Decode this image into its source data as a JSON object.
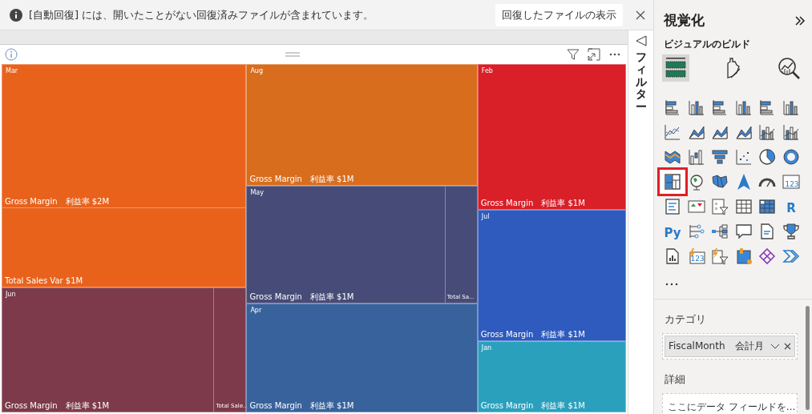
{
  "notification": {
    "message": "[自動回復] には、開いたことがない回復済みファイルが含まれています。",
    "action": "回復したファイルの表示"
  },
  "treemap": {
    "columns": [
      {
        "tiles": [
          {
            "label": "Mar",
            "color": "#e8621c",
            "kind": "rows",
            "segments": [
              {
                "label": "Gross Margin　利益率 $2M"
              },
              {
                "label": "Total Sales Var $1M"
              }
            ]
          },
          {
            "label": "Jun",
            "color": "#7c3a4a",
            "kind": "columns",
            "segments": [
              {
                "label": "Gross Margin　利益率 $1M"
              },
              {
                "label": "Total Sale..."
              }
            ]
          }
        ]
      },
      {
        "tiles": [
          {
            "label": "Aug",
            "color": "#d86d1e",
            "kind": "rows",
            "segments": [
              {
                "label": "Gross Margin　利益率 $1M"
              }
            ]
          },
          {
            "label": "May",
            "color": "#474b77",
            "kind": "columns",
            "segments": [
              {
                "label": "Gross Margin　利益率 $1M"
              },
              {
                "label": "Total Sa..."
              }
            ]
          },
          {
            "label": "Apr",
            "color": "#38629b",
            "kind": "rows",
            "segments": [
              {
                "label": "Gross Margin　利益率 $1M"
              }
            ]
          }
        ]
      },
      {
        "tiles": [
          {
            "label": "Feb",
            "color": "#d91f28",
            "kind": "rows",
            "segments": [
              {
                "label": "Gross Margin　利益率 $1M"
              }
            ]
          },
          {
            "label": "Jul",
            "color": "#2e5bbd",
            "kind": "rows",
            "segments": [
              {
                "label": "Gross Margin　利益率 $1M"
              }
            ]
          },
          {
            "label": "Jan",
            "color": "#2ba0bd",
            "kind": "rows",
            "segments": [
              {
                "label": "Gross Margin　利益率 $1M"
              }
            ]
          }
        ]
      }
    ]
  },
  "filter_pane": {
    "title": "フィルター"
  },
  "visualizations": {
    "title": "視覚化",
    "subtitle": "ビジュアルのビルド",
    "build_tabs": [
      {
        "selected": true
      },
      {
        "selected": false
      },
      {
        "selected": false
      }
    ],
    "visual_types": [
      {
        "kind": "hbar",
        "selected": false
      },
      {
        "kind": "column",
        "selected": false
      },
      {
        "kind": "hbar",
        "selected": false
      },
      {
        "kind": "column",
        "selected": false
      },
      {
        "kind": "hbar",
        "selected": false
      },
      {
        "kind": "column",
        "selected": false
      },
      {
        "kind": "line",
        "selected": false
      },
      {
        "kind": "area",
        "selected": false
      },
      {
        "kind": "area",
        "selected": false
      },
      {
        "kind": "area",
        "selected": false
      },
      {
        "kind": "combo",
        "selected": false
      },
      {
        "kind": "combo",
        "selected": false
      },
      {
        "kind": "ribbon",
        "selected": false
      },
      {
        "kind": "waterfall",
        "selected": false
      },
      {
        "kind": "funnel",
        "selected": false
      },
      {
        "kind": "scatter",
        "selected": false
      },
      {
        "kind": "pie",
        "selected": false
      },
      {
        "kind": "donut",
        "selected": false
      },
      {
        "kind": "treemap",
        "selected": true
      },
      {
        "kind": "globe",
        "selected": false
      },
      {
        "kind": "map",
        "selected": false
      },
      {
        "kind": "arrow",
        "selected": false
      },
      {
        "kind": "gauge",
        "selected": false
      },
      {
        "kind": "card",
        "glyph": "123",
        "selected": false
      },
      {
        "kind": "list",
        "selected": false
      },
      {
        "kind": "kpi",
        "selected": false
      },
      {
        "kind": "slicer",
        "selected": false
      },
      {
        "kind": "table",
        "selected": false
      },
      {
        "kind": "matrix",
        "selected": false
      },
      {
        "kind": "glyph",
        "glyph": "R",
        "selected": false
      },
      {
        "kind": "glyph",
        "glyph": "Py",
        "selected": false
      },
      {
        "kind": "tree",
        "selected": false
      },
      {
        "kind": "decomp",
        "selected": false
      },
      {
        "kind": "bubble",
        "selected": false
      },
      {
        "kind": "doc",
        "selected": false
      },
      {
        "kind": "trophy",
        "selected": false
      },
      {
        "kind": "report",
        "selected": false
      },
      {
        "kind": "boltcard",
        "glyph": "123",
        "selected": false
      },
      {
        "kind": "boltfilter",
        "selected": false
      },
      {
        "kind": "apps",
        "selected": false
      },
      {
        "kind": "diamond",
        "selected": false
      },
      {
        "kind": "chevrons",
        "selected": false
      }
    ],
    "wells": [
      {
        "label": "カテゴリ",
        "field": "FiscalMonth　会計月"
      },
      {
        "label": "詳細",
        "placeholder": "ここにデータ フィールドを..."
      }
    ]
  }
}
